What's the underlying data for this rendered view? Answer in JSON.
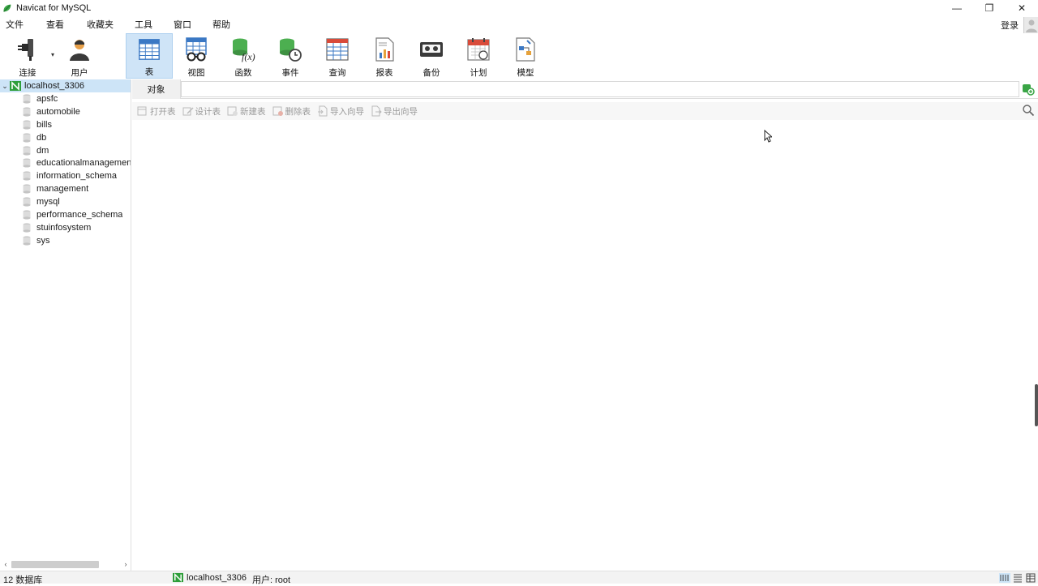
{
  "window": {
    "title": "Navicat for MySQL",
    "minimize": "—",
    "restore": "❐",
    "close": "✕"
  },
  "menubar": {
    "items": [
      "文件",
      "查看",
      "收藏夹",
      "工具",
      "窗口",
      "帮助"
    ],
    "login": "登录"
  },
  "toolbar": {
    "items": [
      {
        "label": "连接",
        "icon": "connection-icon"
      },
      {
        "label": "用户",
        "icon": "user-icon"
      },
      {
        "label": "表",
        "icon": "table-icon",
        "active": true
      },
      {
        "label": "视图",
        "icon": "view-icon"
      },
      {
        "label": "函数",
        "icon": "function-icon"
      },
      {
        "label": "事件",
        "icon": "event-icon"
      },
      {
        "label": "查询",
        "icon": "query-icon"
      },
      {
        "label": "报表",
        "icon": "report-icon"
      },
      {
        "label": "备份",
        "icon": "backup-icon"
      },
      {
        "label": "计划",
        "icon": "schedule-icon"
      },
      {
        "label": "模型",
        "icon": "model-icon"
      }
    ]
  },
  "sidebar": {
    "connection": "localhost_3306",
    "databases": [
      "apsfc",
      "automobile",
      "bills",
      "db",
      "dm",
      "educationalmanagemen",
      "information_schema",
      "management",
      "mysql",
      "performance_schema",
      "stuinfosystem",
      "sys"
    ]
  },
  "objects": {
    "tab": "对象",
    "actions": [
      "打开表",
      "设计表",
      "新建表",
      "删除表",
      "导入向导",
      "导出向导"
    ]
  },
  "status": {
    "count": "12 数据库",
    "connection": "localhost_3306",
    "user": "用户: root"
  },
  "colors": {
    "accent": "#cde4f7",
    "brand_green": "#2e9e3a"
  }
}
